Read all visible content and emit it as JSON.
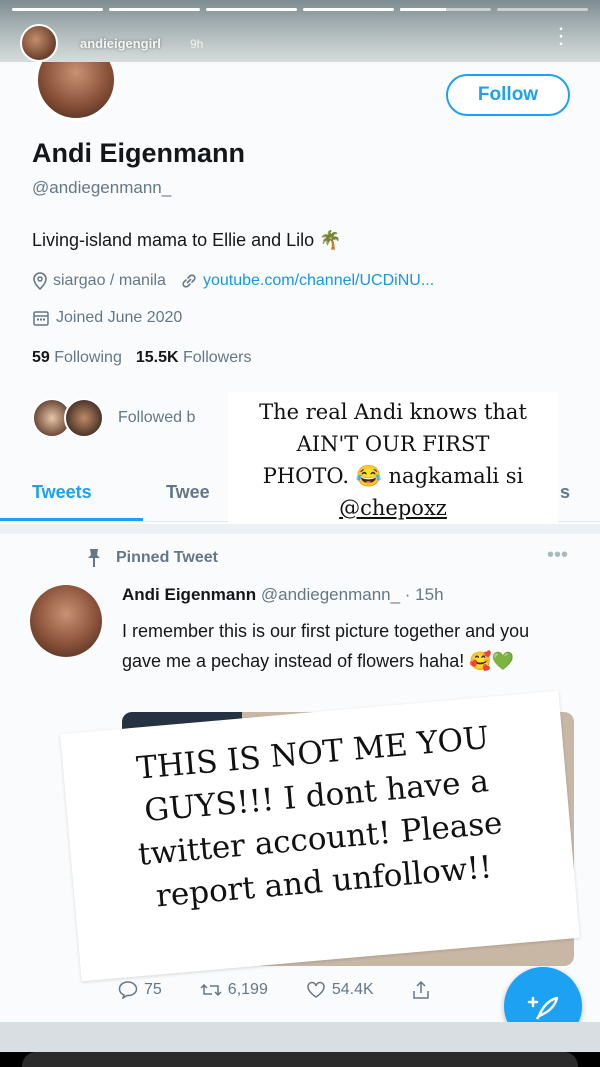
{
  "story": {
    "username": "andieigengirl",
    "time": "9h",
    "progress": [
      1,
      1,
      1,
      1,
      0.5,
      0
    ],
    "more_icon": "more-vertical-icon"
  },
  "profile": {
    "display_name": "Andi Eigenmann",
    "handle": "@andiegenmann_",
    "bio": "Living-island mama to Ellie and Lilo 🌴",
    "location": "siargao / manila",
    "website": "youtube.com/channel/UCDiNU...",
    "joined": "Joined June 2020",
    "following_count": "59",
    "following_label": "Following",
    "followers_count": "15.5K",
    "followers_label": "Followers",
    "followed_by_text": "Followed b",
    "follow_button": "Follow"
  },
  "tabs": [
    {
      "label": "Tweets",
      "active": true
    },
    {
      "label": "Twee"
    },
    {
      "label": "s"
    }
  ],
  "overlay_card": {
    "line1": "The real Andi knows that",
    "line2": "AIN'T OUR FIRST",
    "line3": "PHOTO. 😂 nagkamali si",
    "mention": "@chepoxz"
  },
  "tweet": {
    "pinned_label": "Pinned Tweet",
    "author_name": "Andi Eigenmann",
    "author_handle": "@andiegenmann_",
    "time": "· 15h",
    "text": "I remember this is our first picture together and you gave me a pechay instead of flowers haha! 🥰💚",
    "replies": "75",
    "retweets": "6,199",
    "likes": "54.4K"
  },
  "note_card": {
    "line1": "THIS IS NOT ME YOU",
    "line2": "GUYS!!! I dont have a",
    "line3": "twitter account! Please",
    "line4": "report and unfollow!!"
  },
  "colors": {
    "twitter_blue": "#1da1f2",
    "link_blue": "#1b95e0",
    "secondary_text": "#657786"
  }
}
